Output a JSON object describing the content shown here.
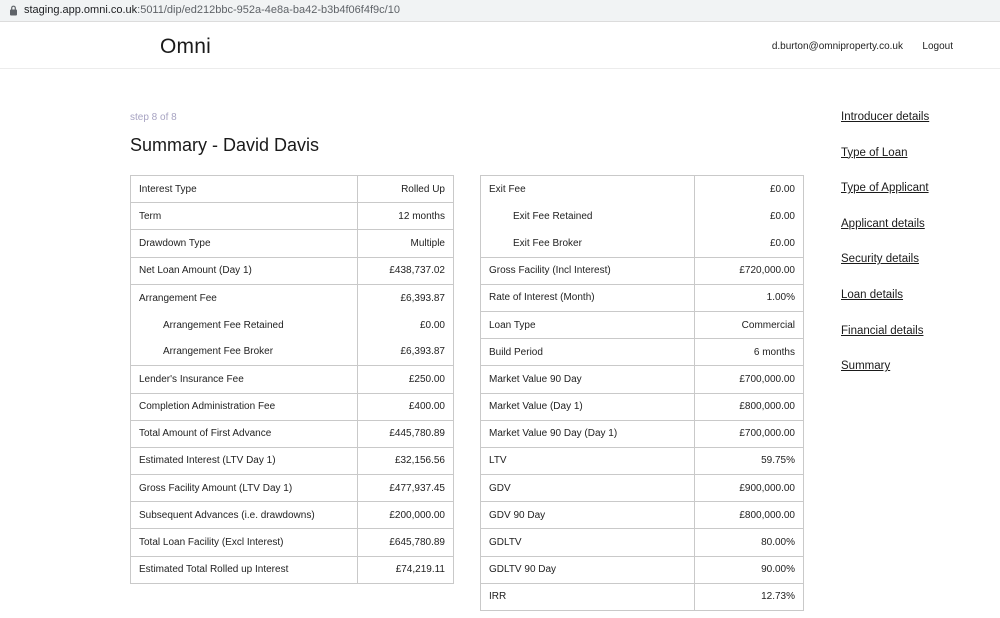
{
  "browser": {
    "url_host": "staging.app.omni.co.uk",
    "url_rest": ":5011/dip/ed212bbc-952a-4e8a-ba42-b3b4f06f4f9c/10"
  },
  "header": {
    "logo": "Omni",
    "email": "d.burton@omniproperty.co.uk",
    "logout": "Logout"
  },
  "page": {
    "step": "step 8 of 8",
    "title": "Summary - David Davis"
  },
  "left_table": [
    {
      "label": "Interest Type",
      "value": "Rolled Up"
    },
    {
      "label": "Term",
      "value": "12 months"
    },
    {
      "label": "Drawdown Type",
      "value": "Multiple"
    },
    {
      "label": "Net Loan Amount (Day 1)",
      "value": "£438,737.02"
    },
    {
      "label": "Arrangement Fee",
      "value": "£6,393.87"
    },
    {
      "label": "Arrangement Fee Retained",
      "value": "£0.00"
    },
    {
      "label": "Arrangement Fee Broker",
      "value": "£6,393.87"
    },
    {
      "label": "Lender's Insurance Fee",
      "value": "£250.00"
    },
    {
      "label": "Completion Administration Fee",
      "value": "£400.00"
    },
    {
      "label": "Total Amount of First Advance",
      "value": "£445,780.89"
    },
    {
      "label": "Estimated Interest (LTV Day 1)",
      "value": "£32,156.56"
    },
    {
      "label": "Gross Facility Amount (LTV Day 1)",
      "value": "£477,937.45"
    },
    {
      "label": "Subsequent Advances (i.e. drawdowns)",
      "value": "£200,000.00"
    },
    {
      "label": "Total Loan Facility (Excl Interest)",
      "value": "£645,780.89"
    },
    {
      "label": "Estimated Total Rolled up Interest",
      "value": "£74,219.11"
    }
  ],
  "right_table": [
    {
      "label": "Exit Fee",
      "value": "£0.00"
    },
    {
      "label": "Exit Fee Retained",
      "value": "£0.00"
    },
    {
      "label": "Exit Fee Broker",
      "value": "£0.00"
    },
    {
      "label": "Gross Facility (Incl Interest)",
      "value": "£720,000.00"
    },
    {
      "label": "Rate of Interest (Month)",
      "value": "1.00%"
    },
    {
      "label": "Loan Type",
      "value": "Commercial"
    },
    {
      "label": "Build Period",
      "value": "6 months"
    },
    {
      "label": "Market Value 90 Day",
      "value": "£700,000.00"
    },
    {
      "label": "Market Value (Day 1)",
      "value": "£800,000.00"
    },
    {
      "label": "Market Value 90 Day (Day 1)",
      "value": "£700,000.00"
    },
    {
      "label": "LTV",
      "value": "59.75%"
    },
    {
      "label": "GDV",
      "value": "£900,000.00"
    },
    {
      "label": "GDV 90 Day",
      "value": "£800,000.00"
    },
    {
      "label": "GDLTV",
      "value": "80.00%"
    },
    {
      "label": "GDLTV 90 Day",
      "value": "90.00%"
    },
    {
      "label": "IRR",
      "value": "12.73%"
    }
  ],
  "sidenav": [
    "Introducer details",
    "Type of Loan",
    "Type of Applicant",
    "Applicant details",
    "Security details",
    "Loan details",
    "Financial details",
    "Summary"
  ]
}
